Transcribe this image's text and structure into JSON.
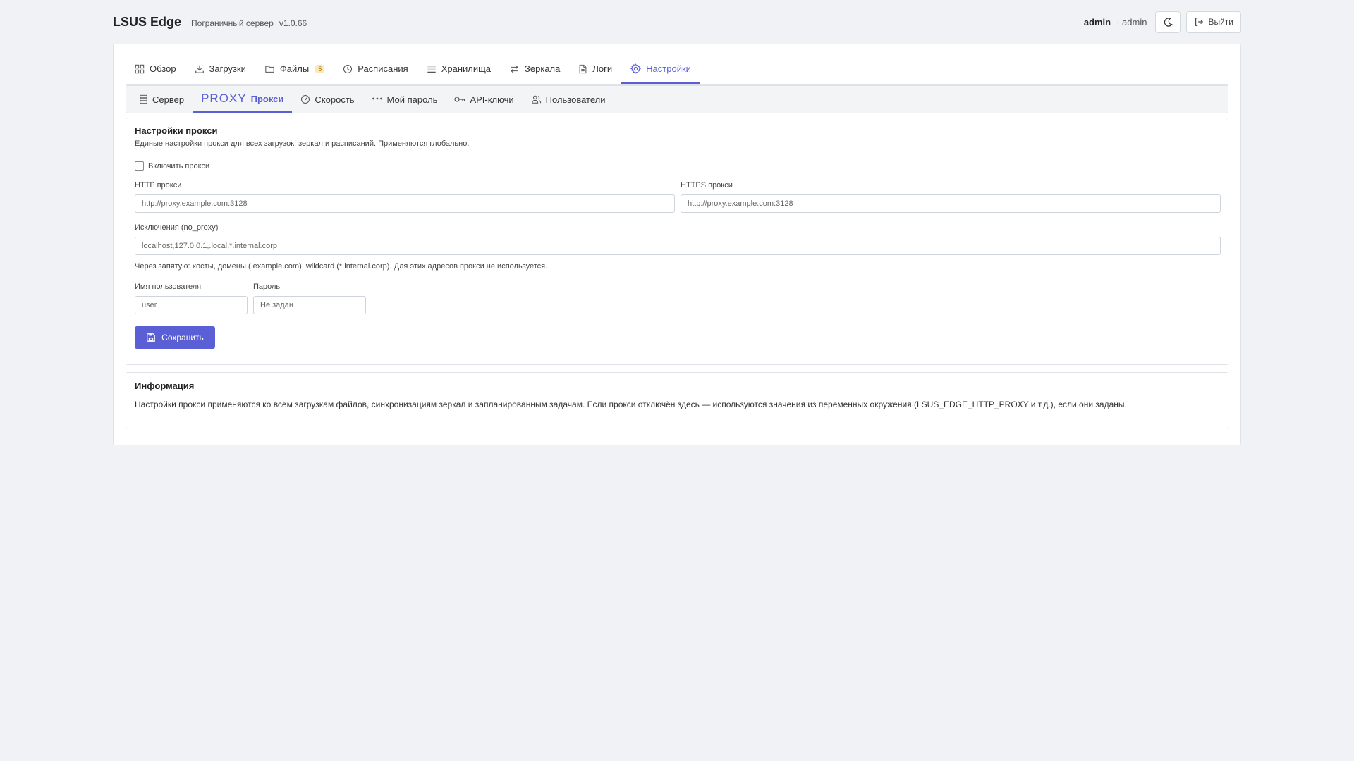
{
  "header": {
    "app_title": "LSUS Edge",
    "subtitle": "Пограничный сервер",
    "version": "v1.0.66",
    "username": "admin",
    "role_sep": "· admin",
    "logout_label": "Выйти"
  },
  "main_tabs": [
    {
      "label": "Обзор",
      "icon": "grid-icon"
    },
    {
      "label": "Загрузки",
      "icon": "download-icon"
    },
    {
      "label": "Файлы",
      "icon": "folder-icon",
      "badge": "5"
    },
    {
      "label": "Расписания",
      "icon": "clock-icon"
    },
    {
      "label": "Хранилища",
      "icon": "storage-icon"
    },
    {
      "label": "Зеркала",
      "icon": "swap-icon"
    },
    {
      "label": "Логи",
      "icon": "file-icon"
    },
    {
      "label": "Настройки",
      "icon": "gear-icon",
      "active": true
    }
  ],
  "sub_tabs": [
    {
      "label": "Сервер",
      "icon": "server-icon"
    },
    {
      "label": "Прокси",
      "logo_text": "PROXY",
      "active": true
    },
    {
      "label": "Скорость",
      "icon": "speedometer-icon"
    },
    {
      "label": "Мой пароль",
      "icon": "dots-icon"
    },
    {
      "label": "API-ключи",
      "icon": "key-icon"
    },
    {
      "label": "Пользователи",
      "icon": "users-icon"
    }
  ],
  "proxy": {
    "title": "Настройки прокси",
    "description": "Единые настройки прокси для всех загрузок, зеркал и расписаний. Применяются глобально.",
    "enable_label": "Включить прокси",
    "enabled": false,
    "http_label": "HTTP прокси",
    "http_placeholder": "http://proxy.example.com:3128",
    "https_label": "HTTPS прокси",
    "https_placeholder": "http://proxy.example.com:3128",
    "no_proxy_label": "Исключения (no_proxy)",
    "no_proxy_placeholder": "localhost,127.0.0.1,.local,*.internal.corp",
    "no_proxy_hint": "Через запятую: хосты, домены (.example.com), wildcard (*.internal.corp). Для этих адресов прокси не используется.",
    "username_label": "Имя пользователя",
    "username_placeholder": "user",
    "password_label": "Пароль",
    "password_placeholder": "Не задан",
    "save_label": "Сохранить"
  },
  "info": {
    "title": "Информация",
    "text": "Настройки прокси применяются ко всем загрузкам файлов, синхронизациям зеркал и запланированным задачам. Если прокси отключён здесь — используются значения из переменных окружения (LSUS_EDGE_HTTP_PROXY и т.д.), если они заданы."
  },
  "colors": {
    "accent": "#5a5fd6",
    "background": "#f1f2f5",
    "badge_bg": "#fde9b8"
  }
}
